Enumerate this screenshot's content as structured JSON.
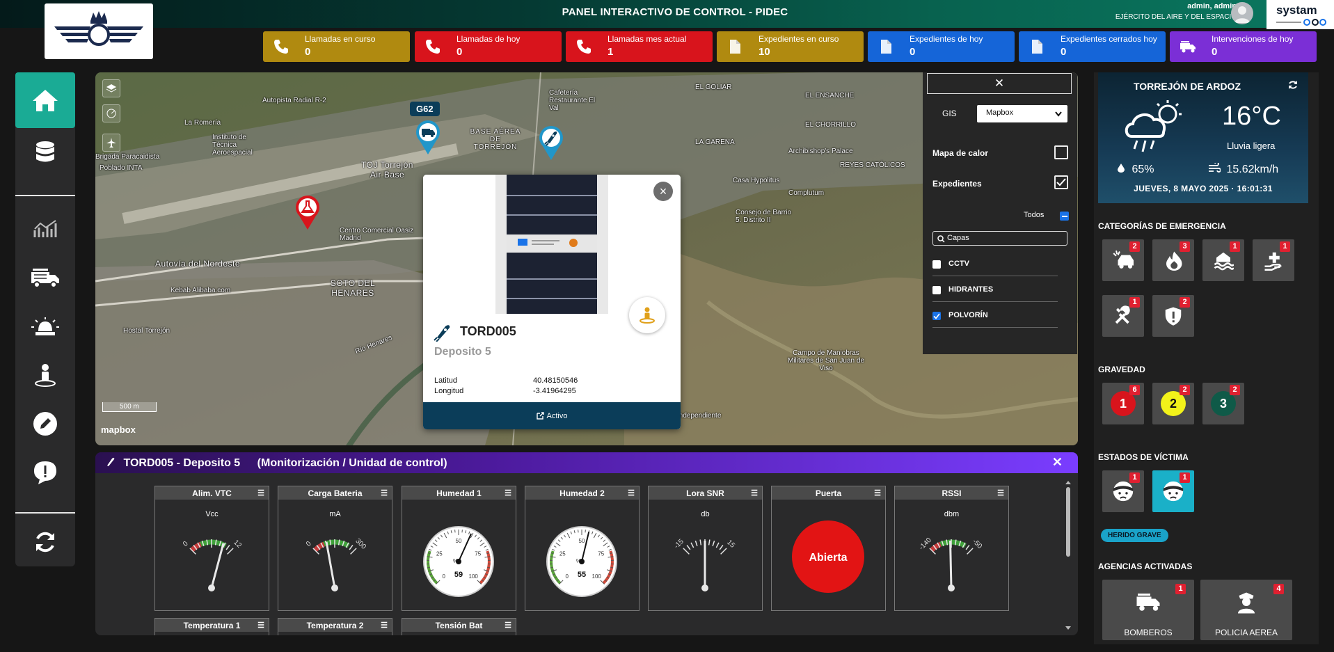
{
  "header": {
    "title": "PANEL INTERACTIVO DE CONTROL - PIDEC",
    "user_name": "admin, admin",
    "user_org": "EJÉRCITO DEL AIRE Y DEL ESPACIO",
    "brand": "systam"
  },
  "stats": [
    {
      "label": "Llamadas en curso",
      "value": "0",
      "color": "#b08a10",
      "icon": "phone-icon"
    },
    {
      "label": "Llamadas de hoy",
      "value": "0",
      "color": "#d8141c",
      "icon": "phone-icon"
    },
    {
      "label": "Llamadas mes actual",
      "value": "1",
      "color": "#d8141c",
      "icon": "phone-icon"
    },
    {
      "label": "Expedientes en curso",
      "value": "10",
      "color": "#b08a10",
      "icon": "file-icon"
    },
    {
      "label": "Expedientes de hoy",
      "value": "0",
      "color": "#1565d8",
      "icon": "file-icon"
    },
    {
      "label": "Expedientes cerrados hoy",
      "value": "0",
      "color": "#1565d8",
      "icon": "file-icon"
    },
    {
      "label": "Intervenciones de hoy",
      "value": "0",
      "color": "#7b2fd6",
      "icon": "fire-truck-icon"
    }
  ],
  "map": {
    "labels": [
      "Autopista Radial R-2",
      "La Romería",
      "Instituto de Técnica Aeroespacial",
      "Brigada Paracaidista",
      "Poblado INTA",
      "TOJ Torrejón Air Base",
      "BASE AÉREA DE TORREJÓN",
      "Centro Comercial Oasiz Madrid",
      "Autovía del Nordeste",
      "Kebab Alibaba.com",
      "Hostal Torrejón",
      "SOTO DEL HENARES",
      "EL GOLIAR",
      "EL ENSANCHE",
      "EL CHORRILLO",
      "LA GARENA",
      "REYES CATÓLICOS",
      "Casa Hypolitus",
      "Consejo de Barrio 5. Distrito II",
      "Complutum",
      "Archibishop's Palace",
      "Campo de Maniobras Militares de San Juan de Viso",
      "Río Henares",
      "Cafetería Restaurante El Val",
      "Independiente"
    ],
    "vehicle_tag": "G62",
    "scale": "500 m",
    "attribution": "mapbox"
  },
  "popup": {
    "id": "TORD005",
    "name": "Deposito 5",
    "lat_label": "Latitud",
    "lat": "40.48150546",
    "lon_label": "Longitud",
    "lon": "-3.41964295",
    "button": "Activo"
  },
  "layers": {
    "close": "✕",
    "gis_label": "GIS",
    "gis_value": "Mapbox",
    "heatmap_label": "Mapa de calor",
    "heatmap_checked": false,
    "files_label": "Expedientes",
    "files_checked": true,
    "todos_label": "Todos",
    "search_placeholder": "Capas",
    "items": [
      {
        "label": "CCTV",
        "checked": false
      },
      {
        "label": "HIDRANTES",
        "checked": false
      },
      {
        "label": "POLVORÍN",
        "checked": true
      }
    ]
  },
  "monitor": {
    "title": "TORD005 - Deposito 5",
    "subtitle": "(Monitorización / Unidad de control)",
    "gauges": [
      {
        "title": "Alim. VTC",
        "unit": "Vcc",
        "kind": "arc",
        "min": "0",
        "max": "12",
        "value": 9.2
      },
      {
        "title": "Carga Bateria",
        "unit": "mA",
        "kind": "arc",
        "min": "0",
        "max": "300",
        "value": 95
      },
      {
        "title": "Humedad 1",
        "unit": "",
        "kind": "round",
        "min": "0",
        "max": "100",
        "value": 59
      },
      {
        "title": "Humedad 2",
        "unit": "",
        "kind": "round",
        "min": "0",
        "max": "100",
        "value": 55
      },
      {
        "title": "Lora SNR",
        "unit": "db",
        "kind": "plain",
        "min": "-15",
        "max": "15",
        "value": 0
      },
      {
        "title": "Puerta",
        "unit": "",
        "kind": "door",
        "state": "Abierta"
      },
      {
        "title": "RSSI",
        "unit": "dbm",
        "kind": "arc",
        "min": "-140",
        "max": "-50",
        "value": -97
      }
    ],
    "gauges_row2": [
      "Temperatura 1",
      "Temperatura 2",
      "Tensión Bat"
    ]
  },
  "weather": {
    "city": "TORREJÓN DE ARDOZ",
    "temp": "16°C",
    "desc": "Lluvia ligera",
    "humidity": "65%",
    "wind": "15.62km/h",
    "datetime": "JUEVES, 8 MAYO 2025 · 16:01:31"
  },
  "categories": {
    "title": "CATEGORÍAS DE EMERGENCIA",
    "items": [
      {
        "icon": "car-crash-icon",
        "count": "2"
      },
      {
        "icon": "fire-icon",
        "count": "3"
      },
      {
        "icon": "flood-icon",
        "count": "1"
      },
      {
        "icon": "medical-aid-icon",
        "count": "1"
      },
      {
        "icon": "tools-icon",
        "count": "1"
      },
      {
        "icon": "shield-alert-icon",
        "count": "2"
      }
    ]
  },
  "severity": {
    "title": "GRAVEDAD",
    "items": [
      {
        "level": "1",
        "count": "6",
        "color": "#d8141c"
      },
      {
        "level": "2",
        "count": "2",
        "color": "#f2f21a"
      },
      {
        "level": "3",
        "count": "2",
        "color": "#0f5a48"
      }
    ]
  },
  "victims": {
    "title": "ESTADOS DE VÍCTIMA",
    "items": [
      {
        "icon": "injured-person-icon",
        "count": "1"
      },
      {
        "icon": "injured-person-icon",
        "count": "1"
      }
    ],
    "tag": "HERIDO GRAVE"
  },
  "agencies": {
    "title": "AGENCIAS ACTIVADAS",
    "items": [
      {
        "name": "BOMBEROS",
        "count": "1",
        "icon": "fire-truck-icon"
      },
      {
        "name": "POLICIA AEREA",
        "count": "4",
        "icon": "police-officer-icon"
      }
    ]
  }
}
